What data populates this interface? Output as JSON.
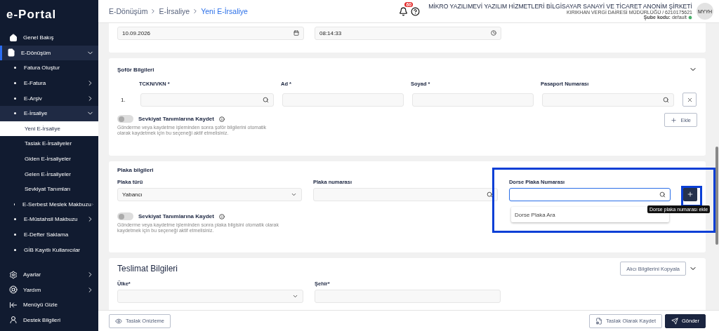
{
  "sidebar": {
    "logo": "e-Portal",
    "items": [
      {
        "label": "Genel Bakış",
        "selected": false
      },
      {
        "label": "E-Dönüşüm",
        "selected": true,
        "expanded": true,
        "children": [
          {
            "label": "Fatura Oluştur",
            "selected": false
          },
          {
            "label": "E-Fatura",
            "selected": false,
            "expanded": false
          },
          {
            "label": "E-Arşiv",
            "selected": false,
            "expanded": false
          },
          {
            "label": "E-İrsaliye",
            "selected": true,
            "expanded": true,
            "children": [
              {
                "label": "Yeni E-İrsaliye",
                "selected": true
              },
              {
                "label": "Taslak E-İrsaliyeler",
                "selected": false
              },
              {
                "label": "Giden E-İrsaliyeler",
                "selected": false
              },
              {
                "label": "Gelen E-İrsaliyeler",
                "selected": false
              },
              {
                "label": "Sevkiyat Tanımları",
                "selected": false
              }
            ]
          },
          {
            "label": "E-Serbest Meslek Makbuzu",
            "selected": false,
            "expanded": false
          },
          {
            "label": "E-Müstahsil Makbuzu",
            "selected": false,
            "expanded": false
          },
          {
            "label": "E-Defter Saklama",
            "selected": false
          },
          {
            "label": "GİB Kayıtlı Kullanıcılar",
            "selected": false
          }
        ]
      }
    ],
    "bottom": [
      {
        "label": "Ayarlar",
        "expanded": false
      },
      {
        "label": "Yardım",
        "expanded": false
      },
      {
        "label": "Menüyü Gizle"
      },
      {
        "label": "Destek Bilgileri"
      }
    ]
  },
  "header": {
    "breadcrumb": [
      {
        "label": "E-Dönüşüm",
        "selected": false
      },
      {
        "label": "E-İrsaliye",
        "selected": false
      },
      {
        "label": "Yeni E-İrsaliye",
        "selected": true
      }
    ],
    "notification_count": "60",
    "company": "MİKRO YAZILIMEVİ YAZILIM HİZMETLERİ BİLGİSAYAR SANAYİ VE TİCARET ANONİM ŞİRKETİ",
    "tax_office": "KIRIKHAN VERGİ DAİRESİ MÜDÜRLÜĞÜ / 6210175621",
    "branch_label": "Şube kodu:",
    "branch_value": "default",
    "avatar": "MYYH"
  },
  "date_row": {
    "date": "10.09.2026",
    "time": "08:14:33"
  },
  "driver": {
    "title": "Şoför Bilgileri",
    "columns": [
      "TCKN/VKN *",
      "Ad *",
      "Soyad *",
      "Pasaport Numarası"
    ],
    "rows": [
      {
        "number": "1."
      }
    ],
    "toggle_label": "Sevkiyat Tanımlarına Kaydet",
    "toggle_on": false,
    "hint": "Gönderme veya kaydetme işleminden sonra şoför bilgilerini otomatik olarak kaydetmek için bu seçeneği aktif etmelisiniz.",
    "add_button": "Ekle"
  },
  "plate": {
    "title": "Plaka bilgileri",
    "type_label": "Plaka türü",
    "type_value": "Yabancı",
    "number_label": "Plaka numarası",
    "trailer_label": "Dorse Plaka Numarası",
    "trailer_option": "Dorse Plaka Ara",
    "tooltip": "Dorse plaka numarası ekle",
    "toggle_label": "Sevkiyat Tanımlarına Kaydet",
    "toggle_on": false,
    "hint": "Gönderme veya kaydetme işleminden sonra plaka bilgisini otomatik olarak kaydetmek için bu seçeneği aktif etmelisiniz."
  },
  "delivery": {
    "title": "Teslimat Bilgileri",
    "copy_button": "Alıcı Bilgilerini Kopyala",
    "country_label": "Ülke*",
    "city_label": "Şehir*"
  },
  "footer": {
    "preview_button": "Taslak Onizleme",
    "save_button": "Taslak Olarak Kaydet",
    "send_button": "Gönder"
  }
}
